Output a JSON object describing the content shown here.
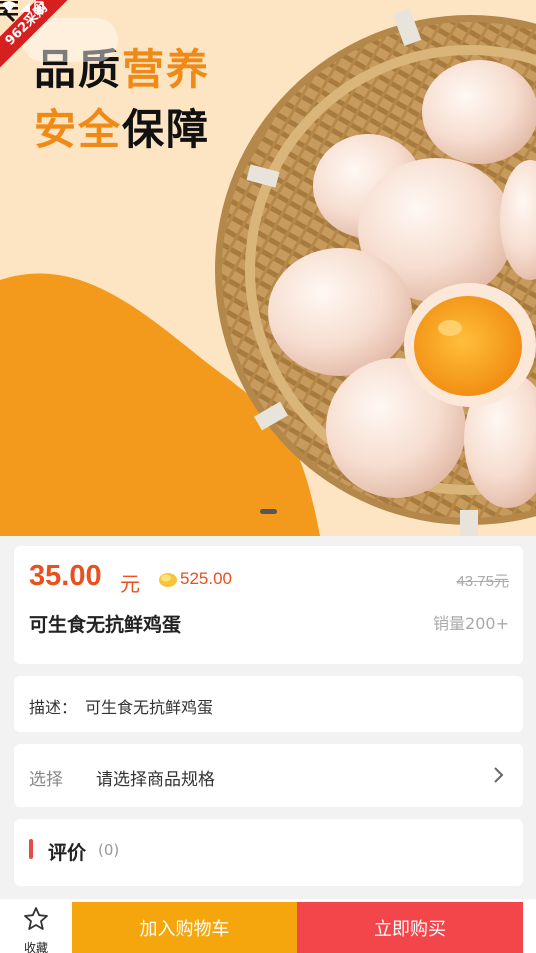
{
  "banner": {
    "corner_badge": "962采购",
    "promo_line1": [
      "品",
      "质",
      "营",
      "养"
    ],
    "promo_line2": [
      "安",
      "全",
      "保",
      "障"
    ]
  },
  "product": {
    "price": "35.00",
    "price_unit": "元",
    "points": "525.00",
    "original_price": "43.75元",
    "name": "可生食无抗鲜鸡蛋",
    "sales": "销量200+"
  },
  "description": {
    "label": "描述：",
    "text": "可生食无抗鲜鸡蛋"
  },
  "spec": {
    "label": "选择",
    "placeholder": "请选择商品规格"
  },
  "review": {
    "title": "评价",
    "count": "(0)"
  },
  "bottom_bar": {
    "favorite_label": "收藏",
    "add_to_cart": "加入购物车",
    "buy_now": "立即购买"
  },
  "colors": {
    "price": "#e8501e",
    "cart_button": "#f5a60d",
    "buy_button": "#f2464b",
    "accent_orange": "#f08a16",
    "banner_bg": "#fde4c2"
  },
  "icons": [
    "back-icon",
    "menu-icon",
    "coin-icon",
    "chevron-right-icon",
    "star-icon",
    "wifi-icon",
    "signal-icon",
    "battery-icon"
  ]
}
